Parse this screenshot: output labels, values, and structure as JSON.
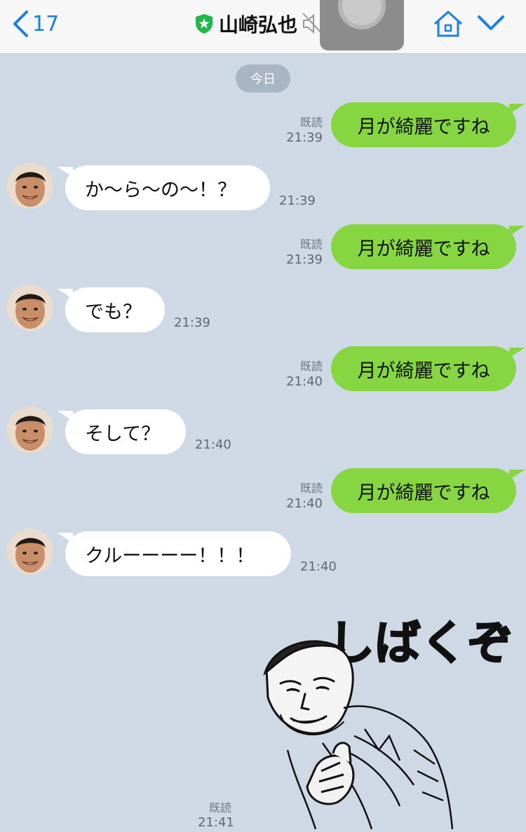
{
  "header": {
    "back_count": "17",
    "contact_name": "山崎弘也"
  },
  "date_separator": "今日",
  "messages": [
    {
      "dir": "out",
      "text": "月が綺麗ですね",
      "read": "既読",
      "time": "21:39"
    },
    {
      "dir": "in",
      "text": "か〜ら〜の〜！？",
      "time": "21:39"
    },
    {
      "dir": "out",
      "text": "月が綺麗ですね",
      "read": "既読",
      "time": "21:39"
    },
    {
      "dir": "in",
      "text": "でも？",
      "time": "21:39"
    },
    {
      "dir": "out",
      "text": "月が綺麗ですね",
      "read": "既読",
      "time": "21:40"
    },
    {
      "dir": "in",
      "text": "そして？",
      "time": "21:40"
    },
    {
      "dir": "out",
      "text": "月が綺麗ですね",
      "read": "既読",
      "time": "21:40"
    },
    {
      "dir": "in",
      "text": "クルーーーー！！！",
      "time": "21:40"
    }
  ],
  "sticker": {
    "caption": "しばくぞ",
    "read": "既読",
    "time": "21:41"
  },
  "colors": {
    "background": "#cfd9e6",
    "outgoing_bubble": "#85d640",
    "incoming_bubble": "#ffffff",
    "accent": "#1a7fe6",
    "verified_badge": "#1fb84a"
  },
  "icons": [
    "chevron-left-icon",
    "verified-shield-icon",
    "mute-icon",
    "home-icon",
    "chevron-down-icon",
    "assistive-touch-icon"
  ]
}
